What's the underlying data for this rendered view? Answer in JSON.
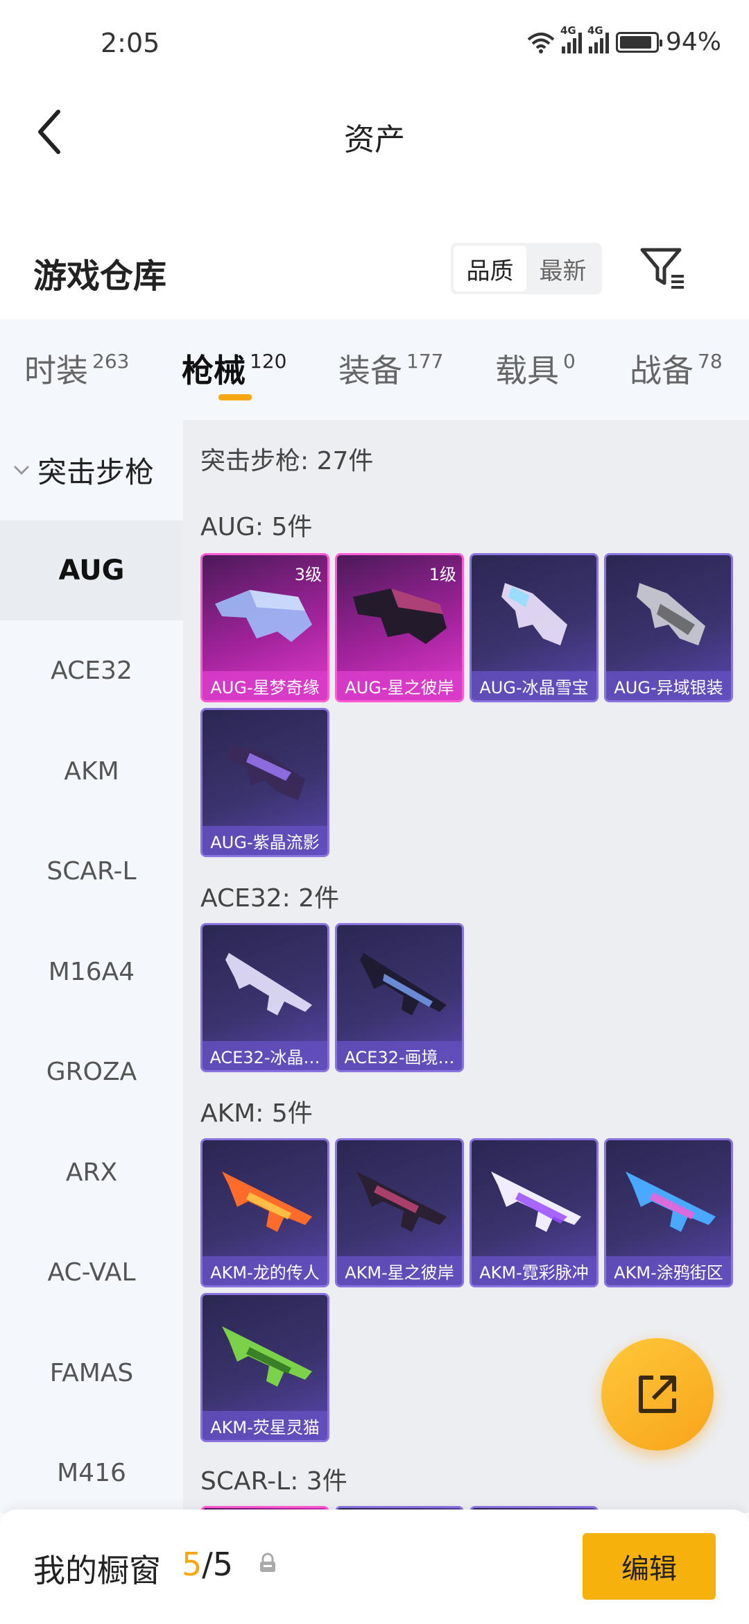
{
  "status": {
    "time": "2:05",
    "battery": "94%",
    "net1": "4G",
    "net2": "4G"
  },
  "header": {
    "title": "资产",
    "back_icon": "chevron-left-icon"
  },
  "warehouse": {
    "title": "游戏仓库",
    "sort_options": [
      "品质",
      "最新"
    ],
    "active_sort": "品质"
  },
  "tabs": [
    {
      "label": "时装",
      "count": "263"
    },
    {
      "label": "枪械",
      "count": "120"
    },
    {
      "label": "装备",
      "count": "177"
    },
    {
      "label": "载具",
      "count": "0"
    },
    {
      "label": "战备",
      "count": "78"
    }
  ],
  "active_tab": "枪械",
  "sidebar": {
    "group": "突击步枪",
    "items": [
      "AUG",
      "ACE32",
      "AKM",
      "SCAR-L",
      "M16A4",
      "GROZA",
      "ARX",
      "AC-VAL",
      "FAMAS",
      "M416"
    ],
    "active": "AUG"
  },
  "content": {
    "summary": "突击步枪: 27件",
    "sections": [
      {
        "title": "AUG: 5件",
        "items": [
          {
            "name": "AUG-星梦奇缘",
            "badge": "3级",
            "rarity": "legendary"
          },
          {
            "name": "AUG-星之彼岸",
            "badge": "1级",
            "rarity": "legendary"
          },
          {
            "name": "AUG-冰晶雪宝",
            "badge": "",
            "rarity": "epic"
          },
          {
            "name": "AUG-异域银装",
            "badge": "",
            "rarity": "epic"
          },
          {
            "name": "AUG-紫晶流影",
            "badge": "",
            "rarity": "epic"
          }
        ]
      },
      {
        "title": "ACE32: 2件",
        "items": [
          {
            "name": "ACE32-冰晶…",
            "badge": "",
            "rarity": "epic"
          },
          {
            "name": "ACE32-画境…",
            "badge": "",
            "rarity": "epic"
          }
        ]
      },
      {
        "title": "AKM: 5件",
        "items": [
          {
            "name": "AKM-龙的传人",
            "badge": "",
            "rarity": "epic"
          },
          {
            "name": "AKM-星之彼岸",
            "badge": "",
            "rarity": "epic"
          },
          {
            "name": "AKM-霓彩脉冲",
            "badge": "",
            "rarity": "epic"
          },
          {
            "name": "AKM-涂鸦街区",
            "badge": "",
            "rarity": "epic"
          },
          {
            "name": "AKM-荧星灵猫",
            "badge": "",
            "rarity": "epic"
          }
        ]
      },
      {
        "title": "SCAR-L: 3件",
        "items": []
      }
    ]
  },
  "showcase": {
    "label": "我的橱窗",
    "current": "5",
    "total": "/5",
    "edit_label": "编辑"
  },
  "colors": {
    "accent": "#f5a814",
    "legendary": "#ff5ad2",
    "epic": "#8b73e0"
  }
}
